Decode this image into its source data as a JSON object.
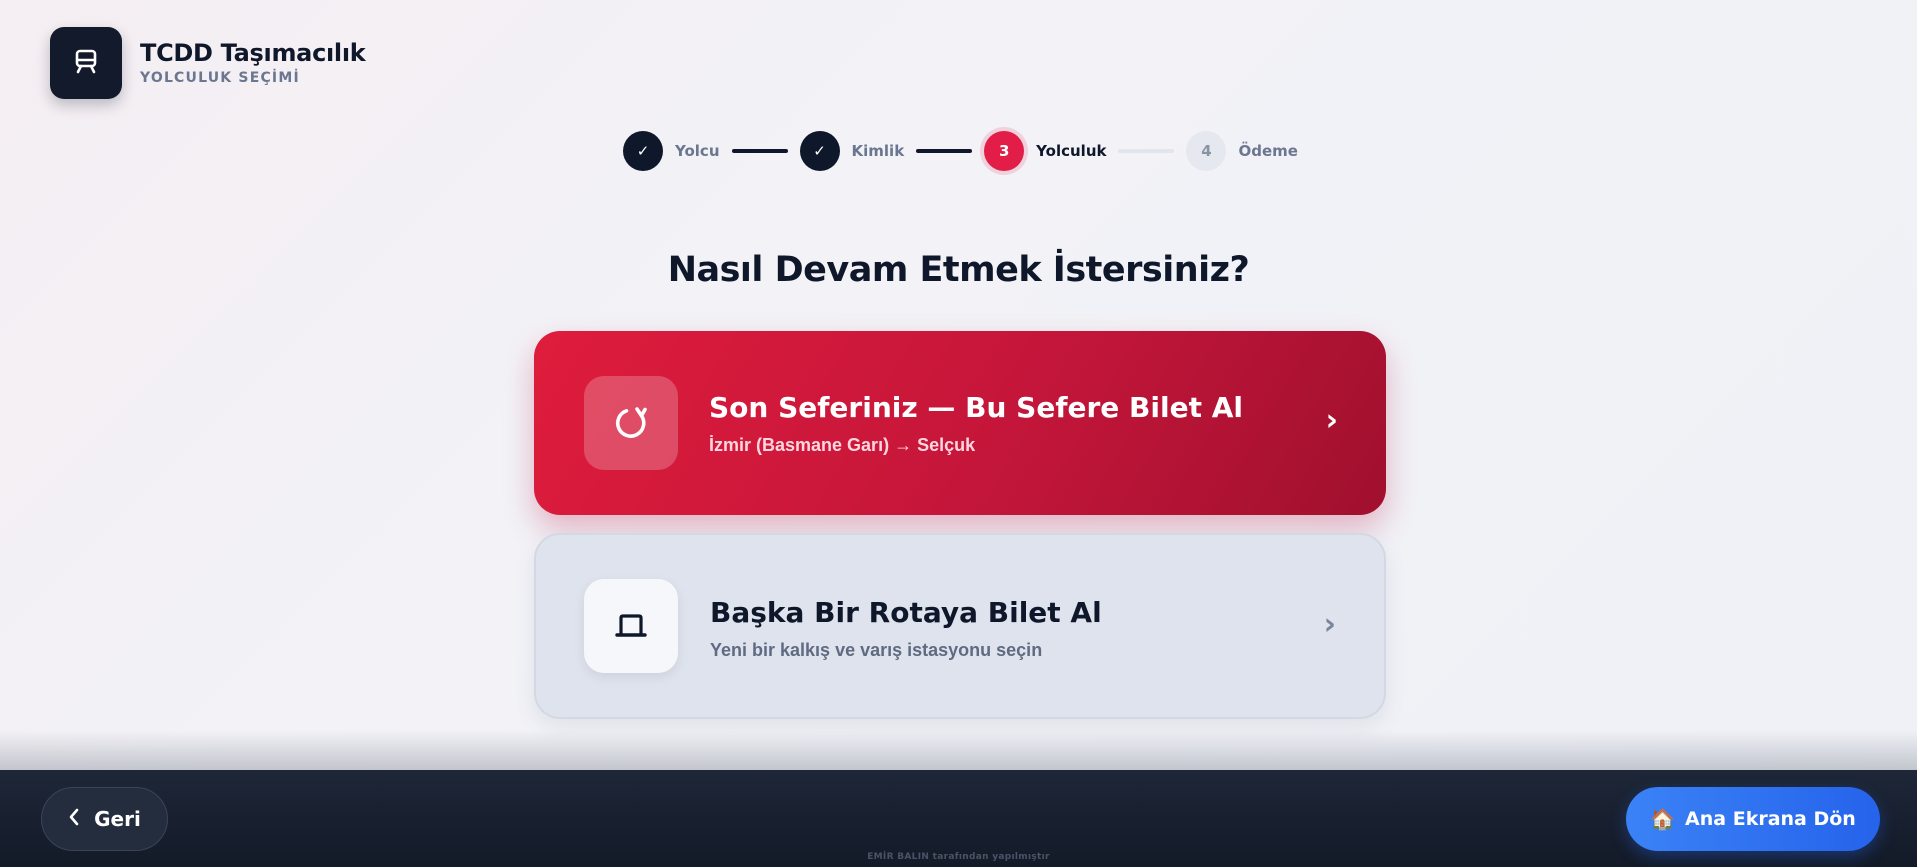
{
  "header": {
    "icon": "train-icon",
    "title": "TCDD Taşımacılık",
    "subtitle": "YOLCULUK SEÇİMİ"
  },
  "stepper": {
    "steps": [
      {
        "marker": "✓",
        "label": "Yolcu",
        "state": "done"
      },
      {
        "marker": "✓",
        "label": "Kimlik",
        "state": "done"
      },
      {
        "marker": "3",
        "label": "Yolculuk",
        "state": "active"
      },
      {
        "marker": "4",
        "label": "Ödeme",
        "state": "todo"
      }
    ]
  },
  "main": {
    "heading": "Nasıl Devam Etmek İstersiniz?",
    "options": [
      {
        "icon": "refresh-icon",
        "title": "Son Seferiniz — Bu Sefere Bilet Al",
        "subtitle": "İzmir (Basmane Garı) → Selçuk",
        "chevron": "›"
      },
      {
        "icon": "train-icon",
        "title": "Başka Bir Rotaya Bilet Al",
        "subtitle": "Yeni bir kalkış ve varış istasyonu seçin",
        "chevron": "›"
      }
    ]
  },
  "footer": {
    "back_label": "Geri",
    "home_emoji": "🏠",
    "home_label": "Ana Ekrana Dön",
    "credit": "EMİR BALIN tarafından yapılmıştır"
  },
  "colors": {
    "accent_red": "#e11d48",
    "navy": "#0f172a",
    "home_blue": "#2563eb"
  }
}
